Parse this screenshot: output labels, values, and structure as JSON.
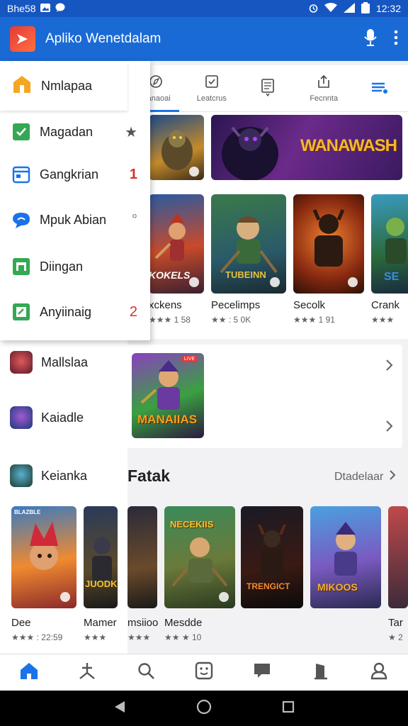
{
  "status": {
    "left_text": "Bhe58",
    "time": "12:32"
  },
  "appbar": {
    "title": "Apliko Wenetdalam"
  },
  "tabs": [
    {
      "label": "Manaoai",
      "icon": "compass-icon"
    },
    {
      "label": "Leatcrus",
      "icon": "check-box-icon"
    },
    {
      "label": "",
      "icon": "list-page-icon"
    },
    {
      "label": "Fecnnta",
      "icon": "share-icon"
    },
    {
      "label": "",
      "icon": "menu-icon"
    }
  ],
  "banner": {
    "text": "WANAWASH"
  },
  "games": [
    {
      "title": "xckens",
      "rating": "★★★ 1 58",
      "art": "KOKELS"
    },
    {
      "title": "Pecelimps",
      "rating": "★★ : 5 0K",
      "art": "TUBEINN"
    },
    {
      "title": "Secolk",
      "rating": "★★★ 1 91",
      "art": ""
    },
    {
      "title": "Crank",
      "rating": "★★★",
      "art": "SE"
    }
  ],
  "promo": {
    "art": "MANAIIAS",
    "tag": "LIVE"
  },
  "section": {
    "title": "Fatak",
    "more": "Dtadelaar"
  },
  "drawer": {
    "header": "Nmlapaa",
    "items": [
      {
        "label": "Magadan",
        "icon": "shield-check-icon",
        "color": "#34a853",
        "mark": "★"
      },
      {
        "label": "Gangkrian",
        "icon": "calendar-icon",
        "color": "#1a73e8",
        "mark": "1"
      },
      {
        "label": "Mpuk Abian",
        "icon": "chat-bubble-icon",
        "color": "#1a73e8",
        "mark": "°"
      },
      {
        "label": "Diingan",
        "icon": "store-icon",
        "color": "#34a853",
        "mark": ""
      },
      {
        "label": "Anyiinaig",
        "icon": "edit-box-icon",
        "color": "#34a853",
        "mark": "2"
      }
    ]
  },
  "left_list": [
    {
      "label": "Mallslaa"
    },
    {
      "label": "Kaiadle"
    },
    {
      "label": "Keianka"
    }
  ],
  "bottom_games": [
    {
      "title": "Dee",
      "rating": "★★★ : 22:59",
      "art": "BLAZBLE"
    },
    {
      "title": "Mamer",
      "rating": "★★★",
      "art": "JUODK"
    },
    {
      "title": "msiioo",
      "rating": "★★★",
      "art": ""
    },
    {
      "title": "Mesdde",
      "rating": "★★ ★ 10",
      "art": "NECEKIIS"
    },
    {
      "title": "",
      "rating": "",
      "art": "TRENGICT"
    },
    {
      "title": "",
      "rating": "",
      "art": "MIKOOS"
    },
    {
      "title": "Tar",
      "rating": "★ 2",
      "art": ""
    }
  ],
  "bottom_nav": [
    "home-icon",
    "star-tool-icon",
    "search-icon",
    "face-box-icon",
    "message-icon",
    "door-icon",
    "profile-icon"
  ],
  "colors": {
    "primary": "#1a6ad6",
    "status_bar": "#1656c0",
    "accent": "#1a73e8"
  }
}
